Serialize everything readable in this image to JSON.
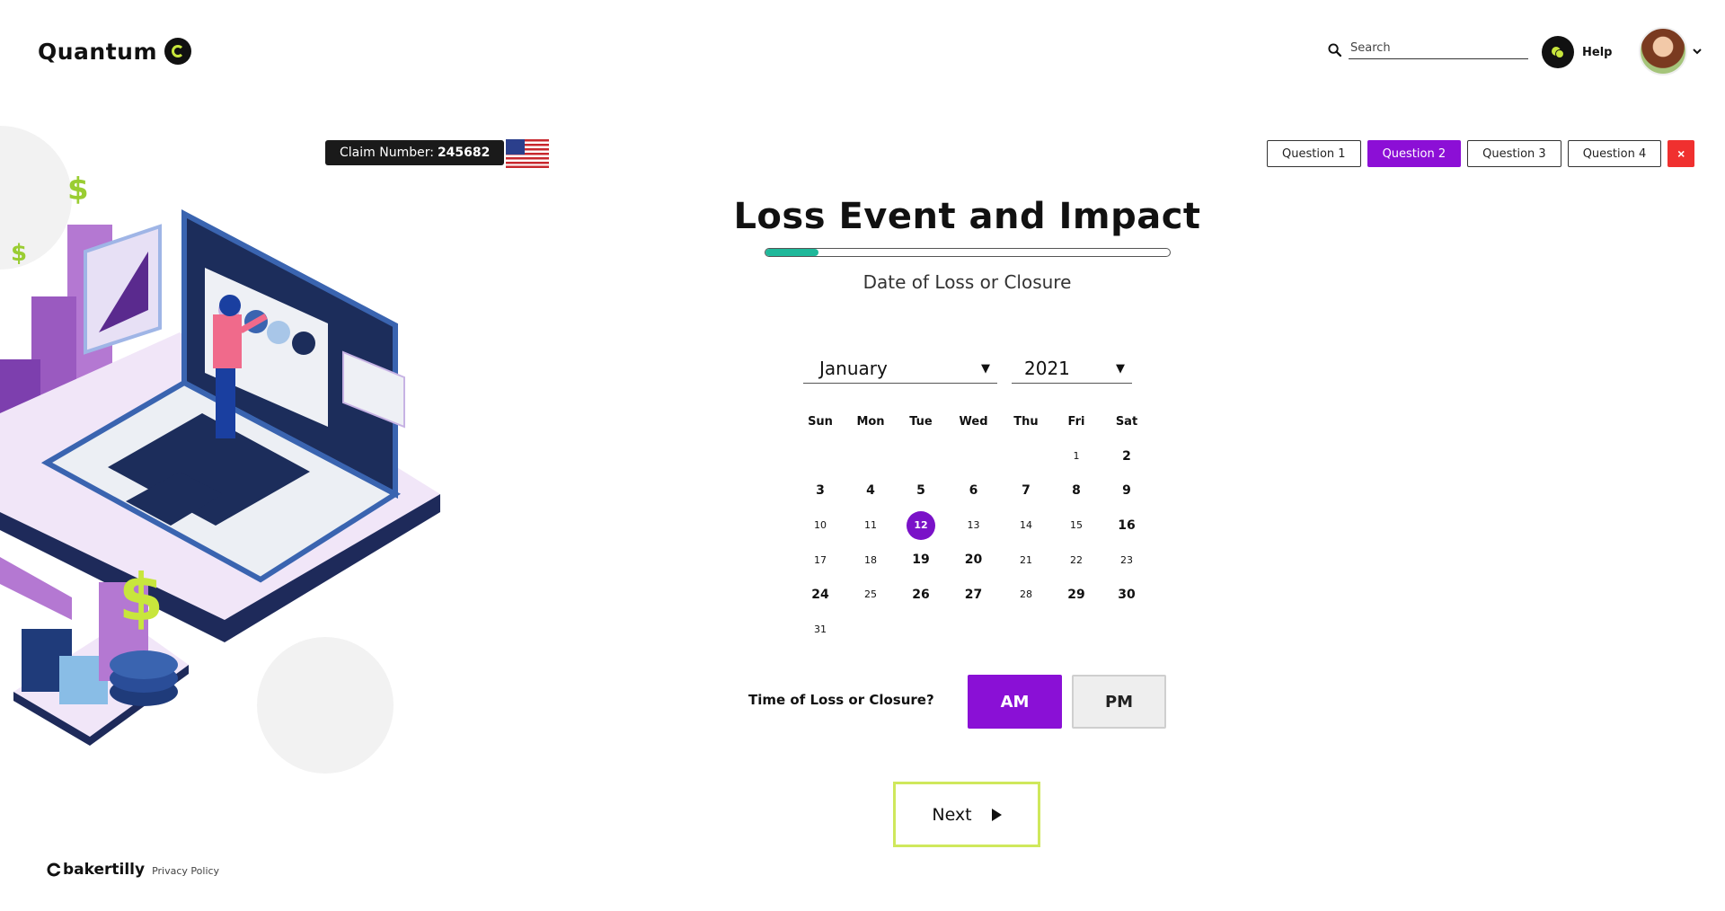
{
  "header": {
    "logo_text": "Quantum",
    "search_placeholder": "Search",
    "help_label": "Help"
  },
  "claim": {
    "label": "Claim Number:",
    "number": "245682"
  },
  "question_tabs": [
    {
      "label": "Question 1",
      "active": false
    },
    {
      "label": "Question 2",
      "active": true
    },
    {
      "label": "Question 3",
      "active": false
    },
    {
      "label": "Question 4",
      "active": false
    }
  ],
  "close_label": "×",
  "page": {
    "title": "Loss Event and Impact",
    "progress_fraction": 0.13,
    "subtitle": "Date of Loss or Closure"
  },
  "calendar": {
    "month": "January",
    "year": "2021",
    "weekdays": [
      "Sun",
      "Mon",
      "Tue",
      "Wed",
      "Thu",
      "Fri",
      "Sat"
    ],
    "weeks": [
      [
        "",
        "",
        "",
        "",
        "",
        "1",
        "2"
      ],
      [
        "3",
        "4",
        "5",
        "6",
        "7",
        "8",
        "9"
      ],
      [
        "10",
        "11",
        "12",
        "13",
        "14",
        "15",
        "16"
      ],
      [
        "17",
        "18",
        "19",
        "20",
        "21",
        "22",
        "23"
      ],
      [
        "24",
        "25",
        "26",
        "27",
        "28",
        "29",
        "30"
      ],
      [
        "31",
        "",
        "",
        "",
        "",
        "",
        ""
      ]
    ],
    "selected_day": "12"
  },
  "time": {
    "label": "Time of Loss or Closure?",
    "am_label": "AM",
    "pm_label": "PM",
    "selected": "AM"
  },
  "next_label": "Next",
  "footer": {
    "brand": "bakertilly",
    "privacy": "Privacy Policy"
  },
  "colors": {
    "accent": "#8c0fd6",
    "progress": "#1fb89a",
    "next_border": "#cfe85c",
    "close": "#f0302f"
  }
}
